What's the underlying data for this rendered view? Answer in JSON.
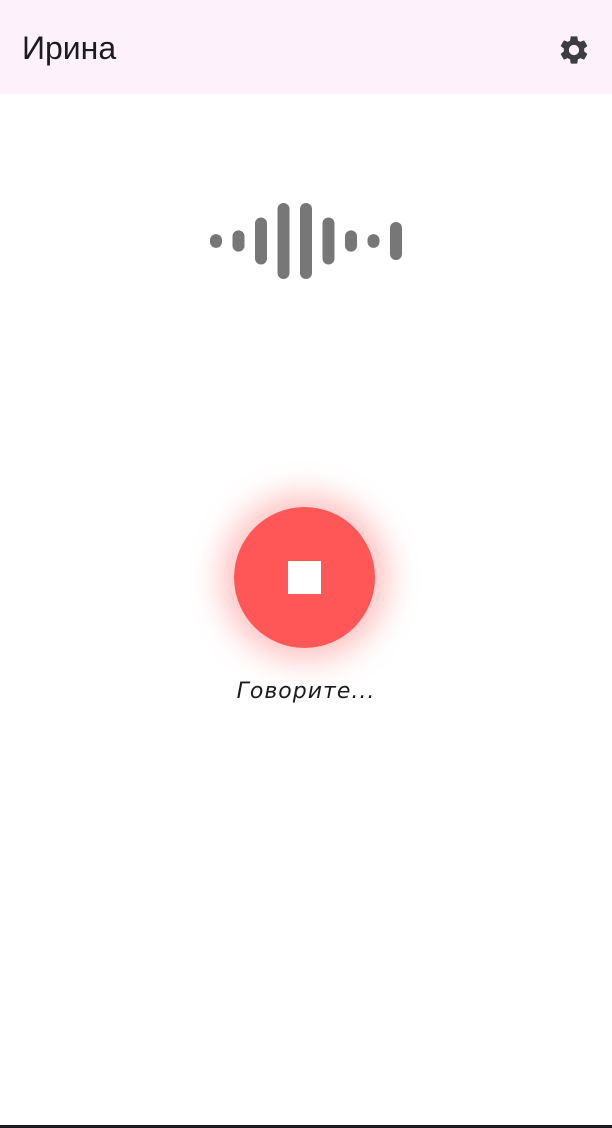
{
  "app_bar": {
    "title": "Ирина",
    "settings_icon": "gear-icon"
  },
  "waveform": {
    "icon": "voice-waveform-icon",
    "color": "#777777",
    "bars": [
      0.18,
      0.28,
      0.62,
      1.0,
      1.0,
      0.62,
      0.28,
      0.18,
      0.5
    ]
  },
  "record": {
    "icon": "stop-icon",
    "color": "#ff5657",
    "status": "Говорите..."
  },
  "colors": {
    "app_bar_bg": "#fdf2fb",
    "text": "#1c1b1f"
  }
}
